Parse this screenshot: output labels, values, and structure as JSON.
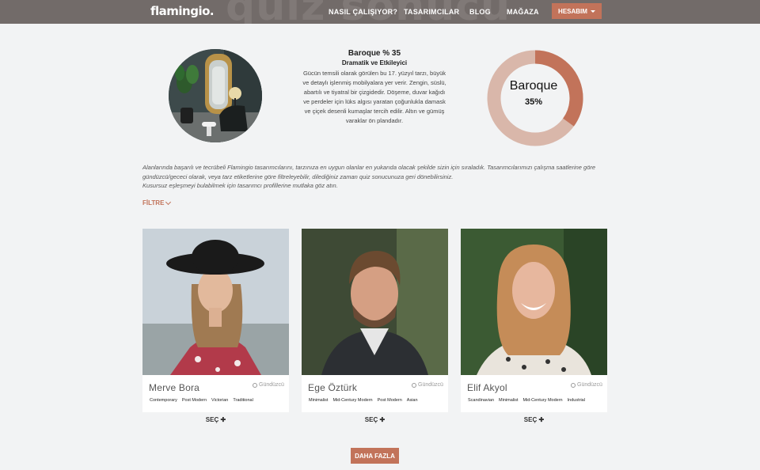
{
  "nav": {
    "logo": "flamingio.",
    "bg_word": "quiz sonucu",
    "links": [
      "NASIL ÇALIŞIYOR?",
      "TASARIMCILAR",
      "BLOG",
      "MAĞAZA"
    ],
    "account": "HESABIM"
  },
  "style": {
    "title": "Baroque % 35",
    "subtitle": "Dramatik ve Etkileyici",
    "description": "Gücün temsili olarak görülen bu 17. yüzyıl tarzı, büyük ve detaylı işlenmiş mobilyalara yer verir. Zengin, süslü, abartılı ve tiyatral bir çizgidedir. Döşeme, duvar kağıdı ve perdeler için lüks algısı yaratan çoğunlukla damask ve çiçek desenli kumaşlar tercih edilir. Altın ve gümüş varaklar ön plandadır.",
    "donut_label": "Baroque",
    "donut_percent_text": "35%",
    "percent": 35,
    "accent_color": "#c2735a",
    "rest_color": "#d9b7aa"
  },
  "intro": {
    "line1": "Alanlarında başarılı ve tecrübeli Flamingio tasarımcılarını, tarzınıza en uygun olanlar en yukarıda olacak şekilde sizin için sıraladık. Tasarımcılarımızı çalışma saatlerine göre gündüzcü/gececi olarak, veya tarz etiketlerine göre filtreleyebilir, dilediğiniz zaman quiz sonucunuza geri dönebilirsiniz.",
    "line2": "Kusursuz eşleşmeyi bulabilmek için tasarımcı profillerine mutlaka göz atın."
  },
  "filter_label": "FİLTRE",
  "designers": [
    {
      "name": "Merve Bora",
      "shift": "Gündüzcü",
      "tags": [
        "Contemporary",
        "Post Modern",
        "Victorian",
        "Traditional"
      ],
      "select": "SEÇ"
    },
    {
      "name": "Ege Öztürk",
      "shift": "Gündüzcü",
      "tags": [
        "Minimalist",
        "Mid-Century Modern",
        "Post Modern",
        "Asian"
      ],
      "select": "SEÇ"
    },
    {
      "name": "Elif Akyol",
      "shift": "Gündüzcü",
      "tags": [
        "Scandinavian",
        "Minimalist",
        "Mid-Century Modern",
        "Industrial"
      ],
      "select": "SEÇ"
    }
  ],
  "more_button": "DAHA FAZLA"
}
